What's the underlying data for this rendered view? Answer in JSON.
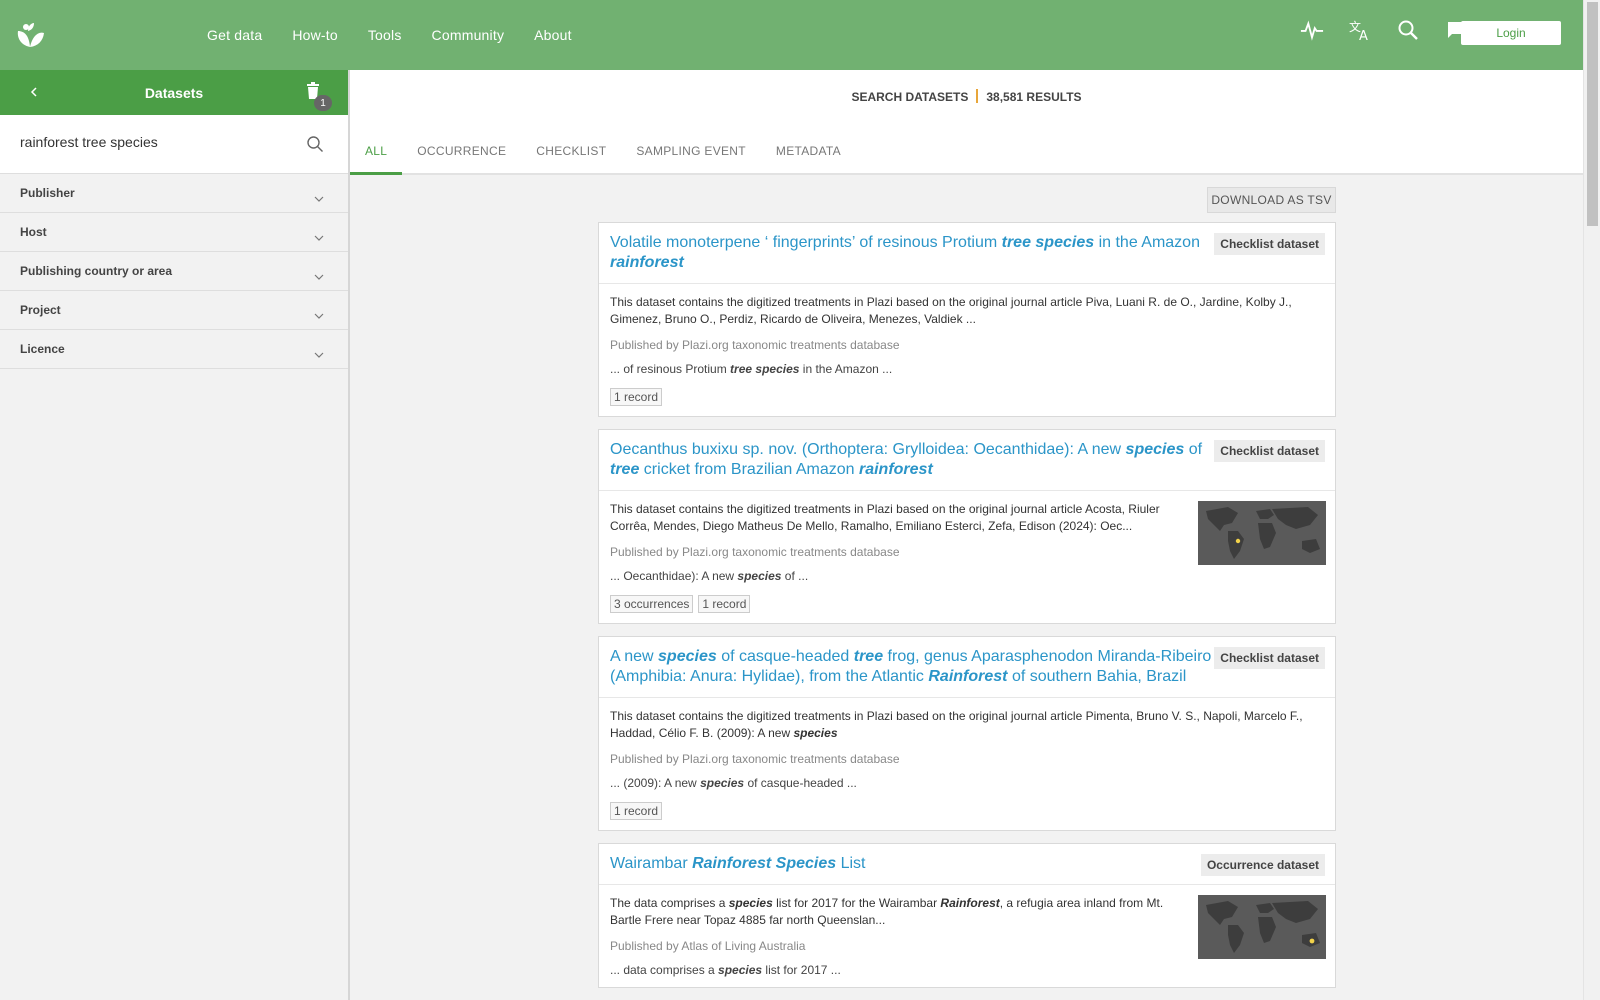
{
  "nav": {
    "items": [
      "Get data",
      "How-to",
      "Tools",
      "Community",
      "About"
    ],
    "login_label": "Login"
  },
  "sidebar": {
    "title": "Datasets",
    "badge_count": "1",
    "search_value": "rainforest tree species",
    "facets": [
      "Publisher",
      "Host",
      "Publishing country or area",
      "Project",
      "Licence"
    ]
  },
  "main": {
    "summary_label": "SEARCH DATASETS",
    "results_count": "38,581 RESULTS",
    "tabs": [
      "ALL",
      "OCCURRENCE",
      "CHECKLIST",
      "SAMPLING EVENT",
      "METADATA"
    ],
    "download_label": "DOWNLOAD AS TSV"
  },
  "cards": [
    {
      "title_parts": [
        {
          "t": "Volatile monoterpene ‘ fingerprints’ of resinous Protium "
        },
        {
          "t": "tree species",
          "em": true
        },
        {
          "t": " in the Amazon "
        },
        {
          "t": "rainforest",
          "em": true
        }
      ],
      "type": "Checklist dataset",
      "description_parts": [
        {
          "t": "This dataset contains the digitized treatments in Plazi based on the original journal article Piva, Luani R. de O., Jardine, Kolby J., Gimenez, Bruno O., Perdiz, Ricardo de Oliveira, Menezes, Valdiek ..."
        }
      ],
      "publisher": "Published by Plazi.org taxonomic treatments database",
      "snippet_parts": [
        {
          "t": "... of resinous Protium "
        },
        {
          "t": "tree species",
          "em": true
        },
        {
          "t": " in the Amazon ..."
        }
      ],
      "tags": [
        "1 record"
      ],
      "map": false
    },
    {
      "title_parts": [
        {
          "t": "Oecanthus buxixu sp. nov. (Orthoptera: Grylloidea: Oecanthidae): A new "
        },
        {
          "t": "species",
          "em": true
        },
        {
          "t": " of "
        },
        {
          "t": "tree",
          "em": true
        },
        {
          "t": " cricket from Brazilian Amazon "
        },
        {
          "t": "rainforest",
          "em": true
        }
      ],
      "type": "Checklist dataset",
      "description_parts": [
        {
          "t": "This dataset contains the digitized treatments in Plazi based on the original journal article Acosta, Riuler Corrêa, Mendes, Diego Matheus De Mello, Ramalho, Emiliano Esterci, Zefa, Edison (2024): Oec..."
        }
      ],
      "publisher": "Published by Plazi.org taxonomic treatments database",
      "snippet_parts": [
        {
          "t": "... Oecanthidae): A new "
        },
        {
          "t": "species",
          "em": true
        },
        {
          "t": " of ..."
        }
      ],
      "tags": [
        "3 occurrences",
        "1 record"
      ],
      "map": true,
      "map_dot": "south-america"
    },
    {
      "title_parts": [
        {
          "t": "A new "
        },
        {
          "t": "species",
          "em": true
        },
        {
          "t": " of casque-headed "
        },
        {
          "t": "tree",
          "em": true
        },
        {
          "t": " frog, genus Aparasphenodon Miranda-Ribeiro (Amphibia: Anura: Hylidae), from the Atlantic "
        },
        {
          "t": "Rainforest",
          "em": true
        },
        {
          "t": " of southern Bahia, Brazil"
        }
      ],
      "type": "Checklist dataset",
      "description_parts": [
        {
          "t": "This dataset contains the digitized treatments in Plazi based on the original journal article Pimenta, Bruno V. S., Napoli, Marcelo F., Haddad, Célio F. B. (2009): A new "
        },
        {
          "t": "species",
          "em": true
        }
      ],
      "publisher": "Published by Plazi.org taxonomic treatments database",
      "snippet_parts": [
        {
          "t": "... (2009): A new "
        },
        {
          "t": "species",
          "em": true
        },
        {
          "t": " of casque-headed ..."
        }
      ],
      "tags": [
        "1 record"
      ],
      "map": false
    },
    {
      "title_parts": [
        {
          "t": "Wairambar "
        },
        {
          "t": "Rainforest Species",
          "em": true
        },
        {
          "t": " List"
        }
      ],
      "type": "Occurrence dataset",
      "description_parts": [
        {
          "t": "The data comprises a "
        },
        {
          "t": "species",
          "em": true
        },
        {
          "t": " list for 2017 for the Wairambar "
        },
        {
          "t": "Rainforest",
          "em": true
        },
        {
          "t": ", a refugia area inland from Mt. Bartle Frere near Topaz 4885 far north Queenslan..."
        }
      ],
      "publisher": "Published by Atlas of Living Australia",
      "snippet_parts": [
        {
          "t": "... data comprises a "
        },
        {
          "t": "species",
          "em": true
        },
        {
          "t": " list for 2017 ..."
        }
      ],
      "tags": [],
      "map": true,
      "map_dot": "australia"
    }
  ],
  "colors": {
    "topbar": "#71b171",
    "sidebar_header": "#4b9e46",
    "link": "#2b95c8",
    "accent_separator": "#e8a63a"
  }
}
